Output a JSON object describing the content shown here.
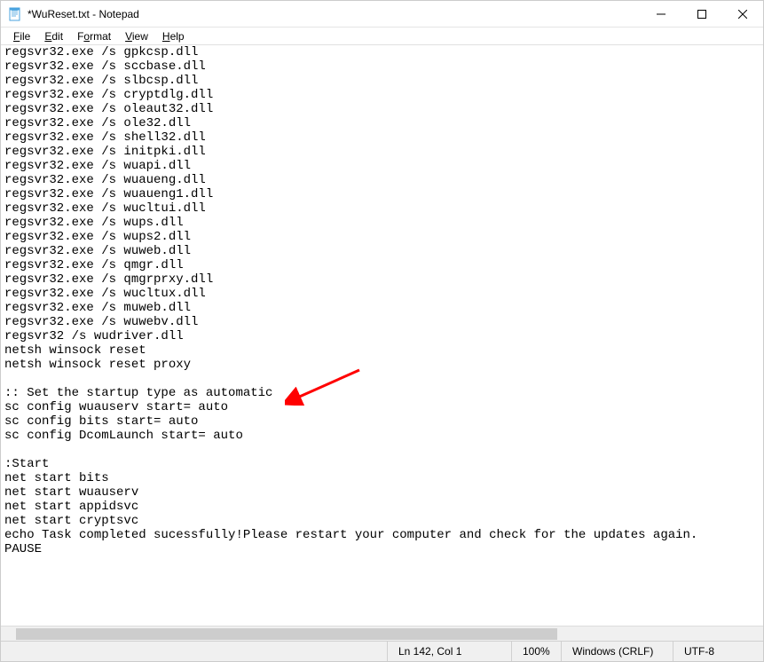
{
  "titlebar": {
    "title": "*WuReset.txt - Notepad"
  },
  "menu": {
    "file": "File",
    "edit": "Edit",
    "format": "Format",
    "view": "View",
    "help": "Help"
  },
  "editor": {
    "content": "regsvr32.exe /s gpkcsp.dll\nregsvr32.exe /s sccbase.dll\nregsvr32.exe /s slbcsp.dll\nregsvr32.exe /s cryptdlg.dll\nregsvr32.exe /s oleaut32.dll\nregsvr32.exe /s ole32.dll\nregsvr32.exe /s shell32.dll\nregsvr32.exe /s initpki.dll\nregsvr32.exe /s wuapi.dll\nregsvr32.exe /s wuaueng.dll\nregsvr32.exe /s wuaueng1.dll\nregsvr32.exe /s wucltui.dll\nregsvr32.exe /s wups.dll\nregsvr32.exe /s wups2.dll\nregsvr32.exe /s wuweb.dll\nregsvr32.exe /s qmgr.dll\nregsvr32.exe /s qmgrprxy.dll\nregsvr32.exe /s wucltux.dll\nregsvr32.exe /s muweb.dll\nregsvr32.exe /s wuwebv.dll\nregsvr32 /s wudriver.dll\nnetsh winsock reset\nnetsh winsock reset proxy\n\n:: Set the startup type as automatic\nsc config wuauserv start= auto\nsc config bits start= auto\nsc config DcomLaunch start= auto\n\n:Start\nnet start bits\nnet start wuauserv\nnet start appidsvc\nnet start cryptsvc\necho Task completed sucessfully!Please restart your computer and check for the updates again.\nPAUSE"
  },
  "statusbar": {
    "position": "Ln 142, Col 1",
    "zoom": "100%",
    "lineending": "Windows (CRLF)",
    "encoding": "UTF-8"
  }
}
